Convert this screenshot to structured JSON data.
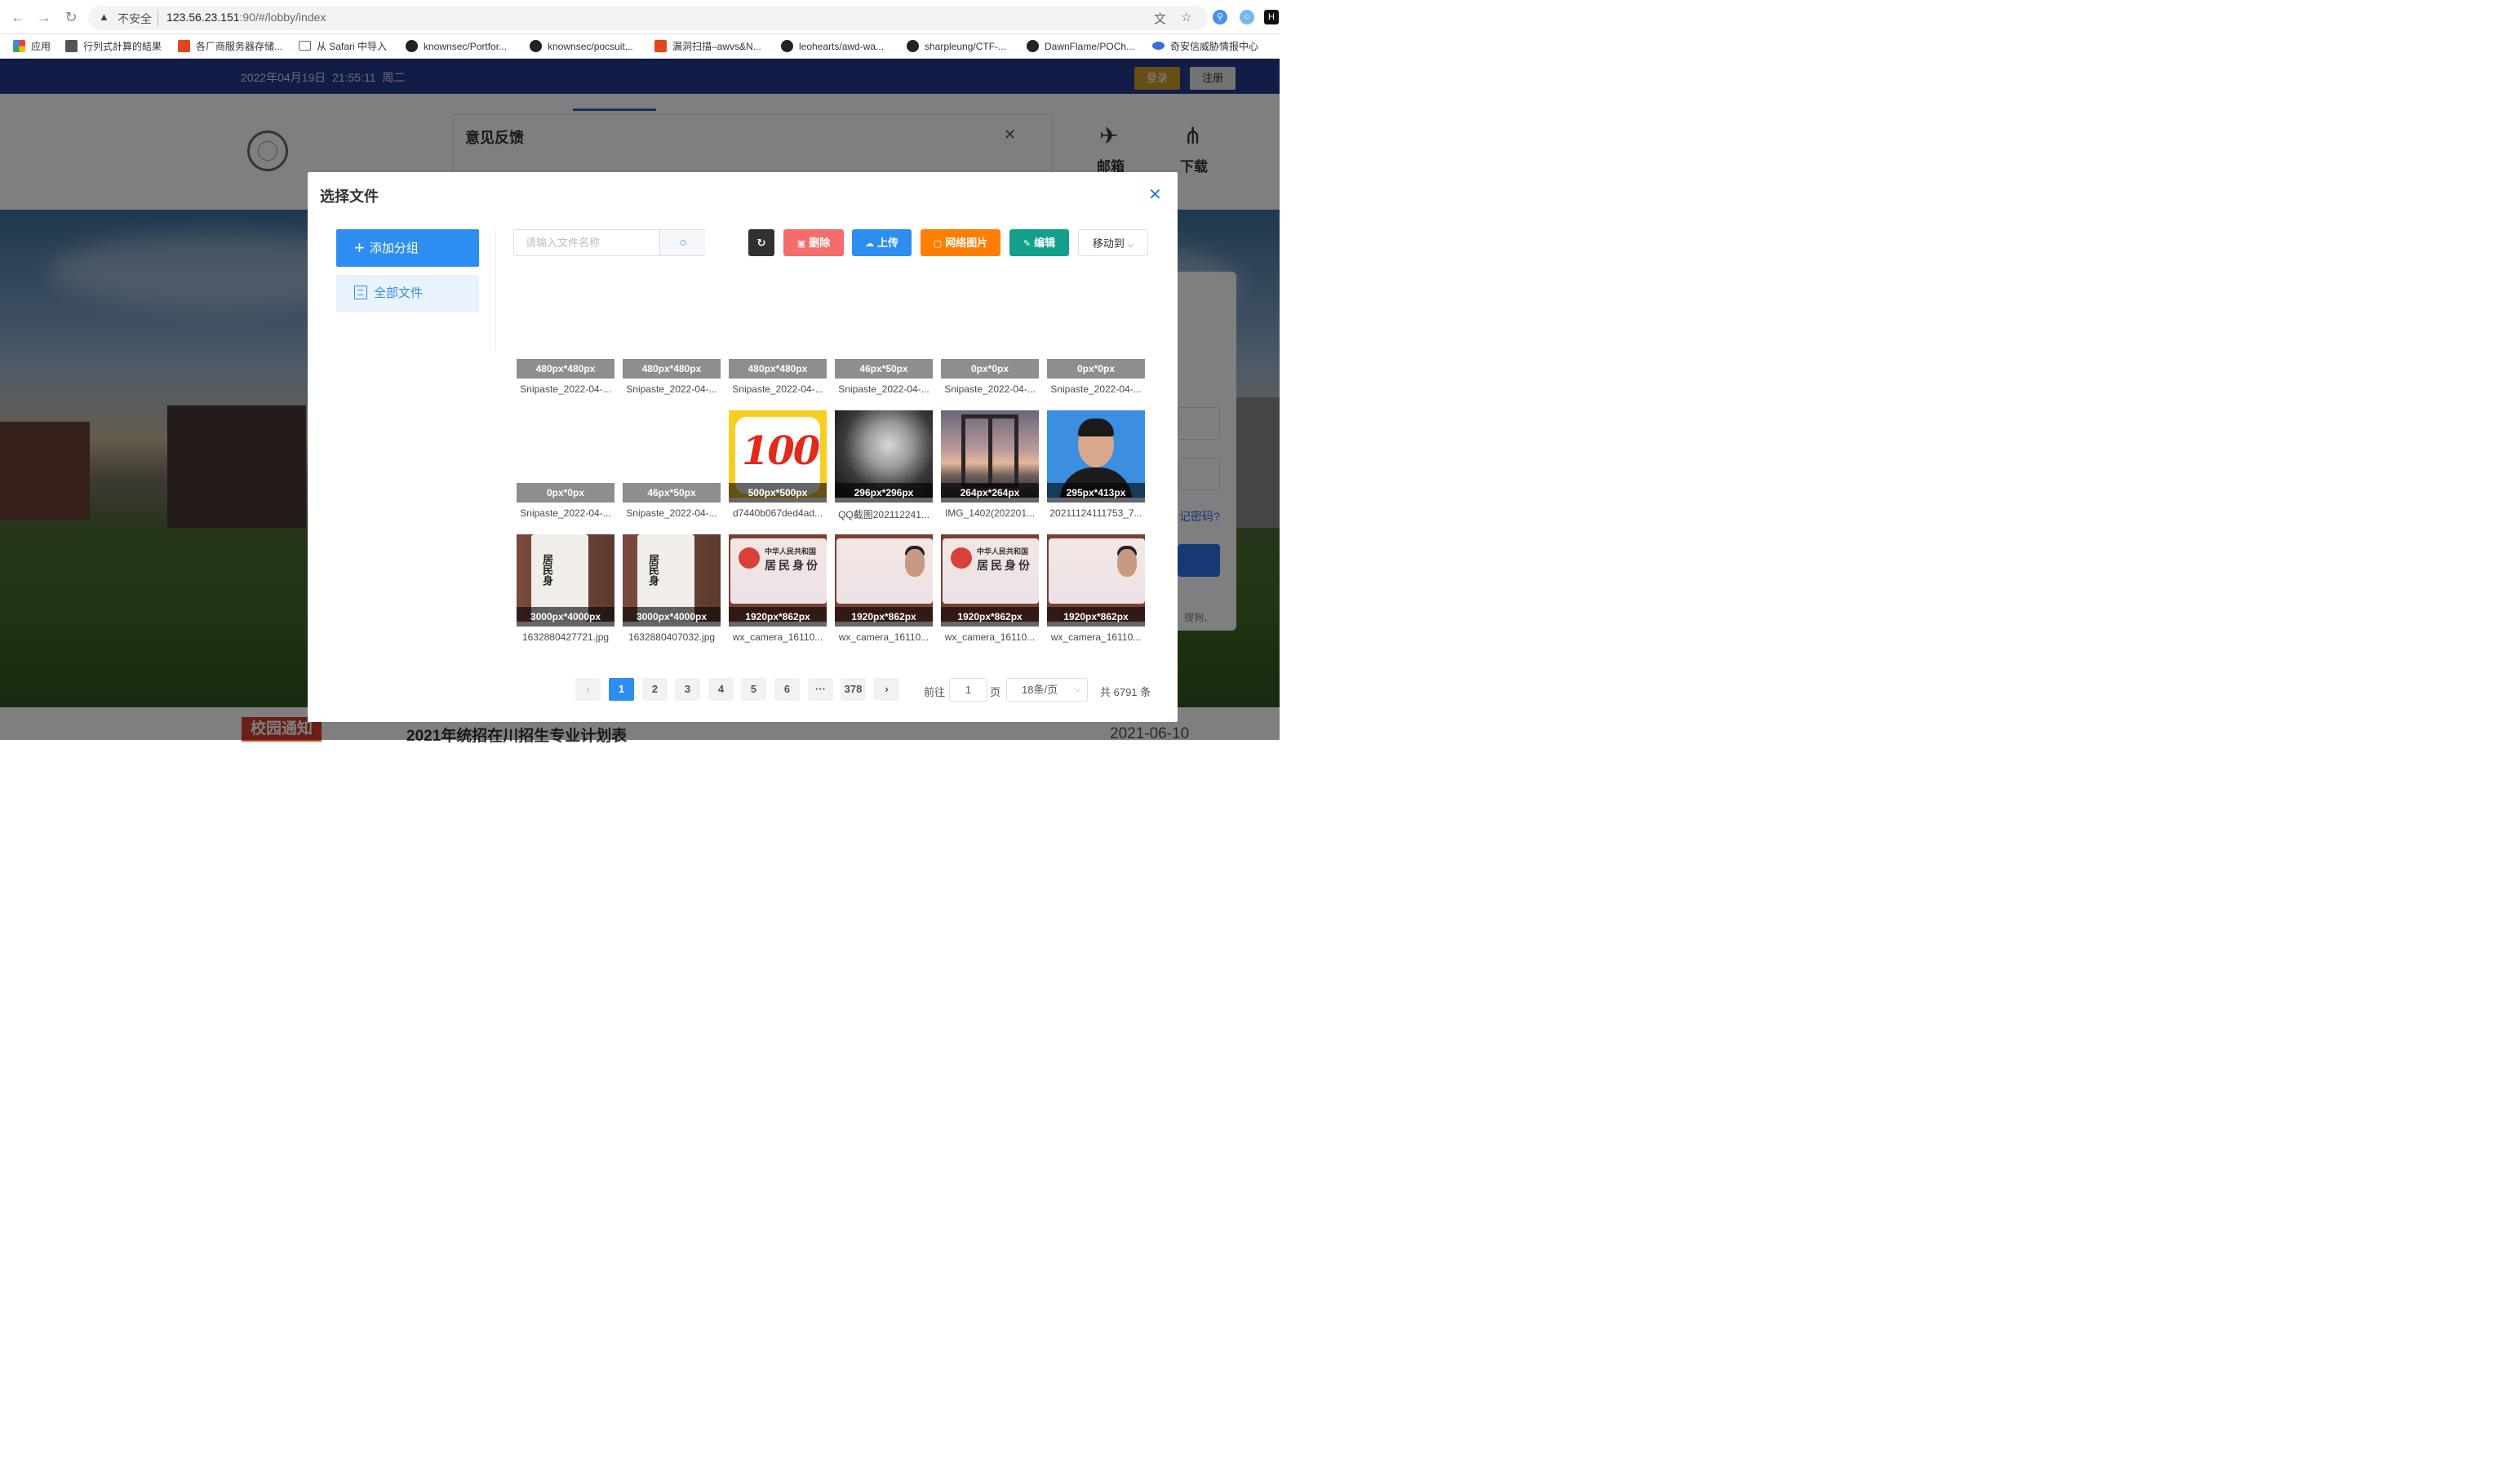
{
  "browser": {
    "insecure_label": "不安全",
    "url_host": "123.56.23.151",
    "url_rest": ":90/#/lobby/index",
    "bookmarks": [
      {
        "icon": "apps",
        "label": "应用"
      },
      {
        "icon": "r",
        "label": "行列式計算的結果"
      },
      {
        "icon": "c",
        "label": "各厂商服务器存储..."
      },
      {
        "icon": "folder",
        "label": "从 Safari 中导入"
      },
      {
        "icon": "github",
        "label": "knownsec/Portfor..."
      },
      {
        "icon": "github",
        "label": "knownsec/pocsuit..."
      },
      {
        "icon": "c",
        "label": "漏洞扫描–awvs&N..."
      },
      {
        "icon": "github",
        "label": "leohearts/awd-wa..."
      },
      {
        "icon": "github",
        "label": "sharpleung/CTF-..."
      },
      {
        "icon": "github",
        "label": "DawnFlame/POCh..."
      },
      {
        "icon": "qax",
        "label": "奇安信威胁情报中心"
      }
    ]
  },
  "site": {
    "date": "2022年04月19日",
    "time": "21:55:11",
    "weekday": "周二",
    "login_label": "登录",
    "register_label": "注册",
    "nav_mail": "邮箱",
    "nav_download": "下载",
    "feedback_title": "意见反馈",
    "forgot_password": "记密码?",
    "sogou_label": "搜狗、",
    "notice_tag": "校园通知",
    "notice_title": "2021年统招在川招生专业计划表",
    "notice_date": "2021-06-10"
  },
  "modal": {
    "title": "选择文件",
    "add_group_label": "添加分组",
    "all_files_label": "全部文件",
    "search_placeholder": "请输入文件名称",
    "toolbar": {
      "delete_label": "删除",
      "upload_label": "上传",
      "net_image_label": "网络图片",
      "edit_label": "编辑",
      "move_label": "移动到"
    },
    "files": [
      {
        "dim": "480px*480px",
        "name": "Snipaste_2022-04-...",
        "thumb": "empty"
      },
      {
        "dim": "480px*480px",
        "name": "Snipaste_2022-04-...",
        "thumb": "empty"
      },
      {
        "dim": "480px*480px",
        "name": "Snipaste_2022-04-...",
        "thumb": "empty"
      },
      {
        "dim": "46px*50px",
        "name": "Snipaste_2022-04-...",
        "thumb": "empty"
      },
      {
        "dim": "0px*0px",
        "name": "Snipaste_2022-04-...",
        "thumb": "empty"
      },
      {
        "dim": "0px*0px",
        "name": "Snipaste_2022-04-...",
        "thumb": "empty"
      },
      {
        "dim": "0px*0px",
        "name": "Snipaste_2022-04-...",
        "thumb": "empty"
      },
      {
        "dim": "46px*50px",
        "name": "Snipaste_2022-04-...",
        "thumb": "empty"
      },
      {
        "dim": "500px*500px",
        "name": "d7440b067ded4ad...",
        "thumb": "app-100"
      },
      {
        "dim": "296px*296px",
        "name": "QQ截图202112241...",
        "thumb": "tiger"
      },
      {
        "dim": "264px*264px",
        "name": "IMG_1402(202201...",
        "thumb": "window"
      },
      {
        "dim": "295px*413px",
        "name": "20211124111753_7...",
        "thumb": "portrait"
      },
      {
        "dim": "3000px*4000px",
        "name": "1632880427721.jpg",
        "thumb": "id-vertical"
      },
      {
        "dim": "3000px*4000px",
        "name": "1632880407032.jpg",
        "thumb": "id-vertical"
      },
      {
        "dim": "1920px*862px",
        "name": "wx_camera_16110...",
        "thumb": "id-front"
      },
      {
        "dim": "1920px*862px",
        "name": "wx_camera_16110...",
        "thumb": "id-back"
      },
      {
        "dim": "1920px*862px",
        "name": "wx_camera_16110...",
        "thumb": "id-front"
      },
      {
        "dim": "1920px*862px",
        "name": "wx_camera_16110...",
        "thumb": "id-back"
      }
    ],
    "thumb_text": {
      "app_number": "100",
      "id_vertical": "居民身",
      "id_country": "中华人民共和国",
      "id_title": "居民身份"
    },
    "pagination": {
      "pages": [
        "1",
        "2",
        "3",
        "4",
        "5",
        "6",
        "···",
        "378"
      ],
      "current": "1",
      "goto_prefix": "前往",
      "goto_value": "1",
      "goto_suffix": "页",
      "page_size": "18条/页",
      "total": "共 6791 条"
    }
  }
}
